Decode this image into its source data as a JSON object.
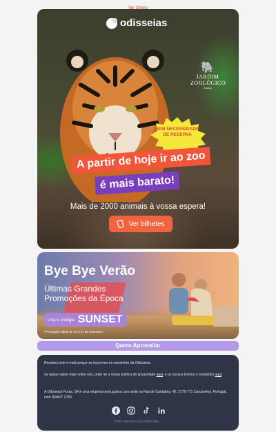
{
  "top": {
    "view_online": "Ver Online"
  },
  "hero": {
    "brand": "odisseias",
    "zoo_line1": "JARDIM",
    "zoo_line2": "ZOOLÓGICO",
    "zoo_sub": "Lisboa",
    "badge": "SEM NECESSIDADE DE RESERVA",
    "headline1": "A partir de hoje ir ao zoo",
    "headline2": "é mais barato!",
    "subtitle": "Mais de 2000 animais à vossa espera!",
    "cta": "Ver bilhetes"
  },
  "promo": {
    "title": "Bye Bye Verão",
    "subtitle1": "Últimas Grandes",
    "subtitle2": "Promoções da Época",
    "code_label": "Usa o código:",
    "code": "SUNSET",
    "note": "*Promoção válida de 18 a 21 de Setembro."
  },
  "cta2": "Quero Aproveitar",
  "footer": {
    "line1": "Recebeu este e-mail porque se inscreveu na newsletter da Odisseias.",
    "line2_a": "Se quiser saber mais sobre nós, pode ler a nossa política de privacidade ",
    "link_aqui": "aqui",
    "line2_b": ", e os nossos termos e condições ",
    "line3": "A Odisseias Puras, SA é uma empresa portuguesa com sede na Rua de Cantábria, 42, 2775-771 Carcavelos, Portugal, com RNAVT 2780.",
    "unsubscribe": "Pode cancelar a sua subscrição..."
  },
  "colors": {
    "accent": "#f2563a",
    "purple": "#7a3dbb",
    "lavender": "#b49ae8",
    "footer_bg": "#2f3547"
  },
  "icons": [
    "facebook-icon",
    "instagram-icon",
    "tiktok-icon",
    "linkedin-icon"
  ]
}
